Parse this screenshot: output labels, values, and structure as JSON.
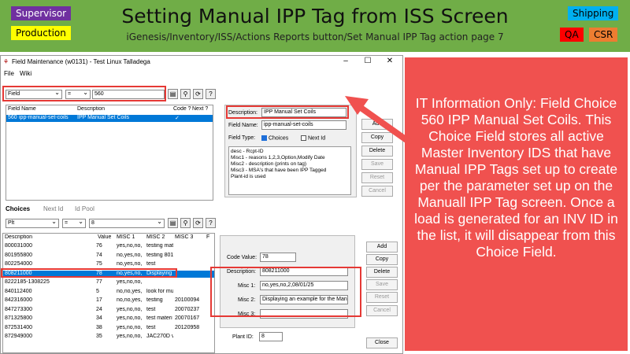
{
  "header": {
    "title": "Setting Manual IPP Tag from ISS Screen",
    "subtitle": "iGenesis/Inventory/ISS/Actions Reports button/Set Manual IPP Tag action page 7",
    "tags": {
      "supervisor": "Supervisor",
      "production": "Production",
      "shipping": "Shipping",
      "qa": "QA",
      "csr": "CSR"
    }
  },
  "window": {
    "title": "Field Maintenance (w0131) - Test Linux Talladega",
    "menu": [
      "File",
      "Wiki"
    ],
    "filter": {
      "field": "Field",
      "operator": "=",
      "value": "560"
    },
    "top_grid": {
      "headers": [
        "Field Name",
        "Description",
        "Code ?",
        "Next ?"
      ],
      "rows": [
        {
          "field": "560",
          "name": "ipp-manual-set-coils",
          "description": "IPP Manual Set Coils",
          "code": "✓",
          "next": ""
        }
      ]
    },
    "detail": {
      "description_label": "Description:",
      "description_value": "IPP Manual Set Coils",
      "field_name_label": "Field Name:",
      "field_name_value": "ipp-manual-set-coils",
      "field_type_label": "Field Type:",
      "choices_label": "Choices",
      "next_id_label": "Next Id",
      "memo": [
        "desc - Rcpt-ID",
        "Misc1 - reasons 1,2,3,Option,Modify Date",
        "Misc2 - description (prints on tag)",
        "Misc3 - MSA's that have been IPP Tagged",
        "Plant-id is used"
      ]
    },
    "top_buttons": [
      "Add",
      "Copy",
      "Delete",
      "Save",
      "Reset",
      "Cancel"
    ],
    "tabs": [
      "Choices",
      "Next Id",
      "Id Pool"
    ],
    "choice_filter": {
      "field": "Plt",
      "operator": "=",
      "value": "8"
    },
    "choices_grid": {
      "headers": [
        "Description",
        "Value",
        "MISC 1",
        "MISC 2",
        "MISC 3",
        "F"
      ],
      "rows": [
        {
          "d": "800031000",
          "v": "76",
          "m1": "yes,no,no,",
          "m2": "testing mat",
          "m3": ""
        },
        {
          "d": "801955800",
          "v": "74",
          "m1": "no,yes,no,",
          "m2": "testing 801",
          "m3": ""
        },
        {
          "d": "802254000",
          "v": "75",
          "m1": "no,yes,no,",
          "m2": "test",
          "m3": ""
        },
        {
          "d": "808211000",
          "v": "78",
          "m1": "no,yes,no,",
          "m2": "Displaying",
          "m3": ""
        },
        {
          "d": "8222185-1308225",
          "v": "77",
          "m1": "yes,no,no,",
          "m2": "",
          "m3": ""
        },
        {
          "d": "840112400",
          "v": "5",
          "m1": "no,no,yes,",
          "m2": "look for mu",
          "m3": ""
        },
        {
          "d": "842316000",
          "v": "17",
          "m1": "no,no,yes,",
          "m2": "testing",
          "m3": "20100094"
        },
        {
          "d": "847273300",
          "v": "24",
          "m1": "yes,no,no,",
          "m2": "test",
          "m3": "20070237"
        },
        {
          "d": "871325800",
          "v": "34",
          "m1": "yes,no,no,",
          "m2": "test materi",
          "m3": "20070167"
        },
        {
          "d": "872531400",
          "v": "38",
          "m1": "yes,no,no,",
          "m2": "test",
          "m3": "20120958"
        },
        {
          "d": "872949000",
          "v": "35",
          "m1": "yes,no,no,",
          "m2": "JAC270D v",
          "m3": ""
        }
      ]
    },
    "choice_detail": {
      "code_value_label": "Code Value:",
      "code_value": "78",
      "description_label": "Description:",
      "description_value": "808211000",
      "misc1_label": "Misc 1:",
      "misc1_value": "no,yes,no,2,08/01/25",
      "misc2_label": "Misc 2:",
      "misc2_value": "Displaying an example for the Manua",
      "misc3_label": "Misc 3:",
      "misc3_value": "",
      "plant_label": "Plant ID:",
      "plant_value": "8"
    },
    "bottom_buttons": [
      "Add",
      "Copy",
      "Delete",
      "Save",
      "Reset",
      "Cancel"
    ],
    "close_label": "Close"
  },
  "callout": {
    "text": "IT Information Only: Field Choice 560 IPP Manual Set Coils. This Choice Field stores all active Master Inventory IDS that have Manual IPP Tags set up to create per the parameter set up on the Manuall IPP Tag screen. Once a load is generated for an INV ID in the list, it will disappear from this Choice Field."
  },
  "colors": {
    "banner": "#70ad47",
    "callout": "#f0514f",
    "highlight": "#e53935",
    "selection": "#0078d7"
  }
}
